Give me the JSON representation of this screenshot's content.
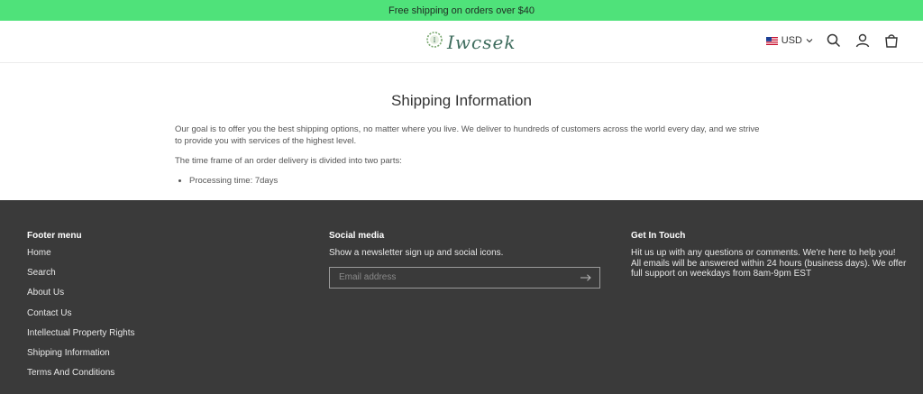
{
  "announcement": "Free shipping on orders over $40",
  "header": {
    "logo_text": "Iwcsek",
    "currency": "USD",
    "icons": [
      "search-icon",
      "account-icon",
      "cart-icon"
    ]
  },
  "main": {
    "title": "Shipping Information",
    "paragraphs": [
      "Our goal is to offer you the best shipping options, no matter where you live. We deliver to hundreds of customers across the world every day, and we strive to provide you with services of the highest level.",
      "The time frame of an order delivery is divided into two parts:"
    ],
    "bullets": [
      "Processing time: 7days"
    ]
  },
  "footer": {
    "menu": {
      "heading": "Footer menu",
      "items": [
        "Home",
        "Search",
        "About Us",
        "Contact Us",
        "Intellectual Property Rights",
        "Shipping Information",
        "Terms And Conditions"
      ]
    },
    "social": {
      "heading": "Social media",
      "text": "Show a newsletter sign up and social icons.",
      "email_placeholder": "Email address"
    },
    "touch": {
      "heading": "Get In Touch",
      "lines": [
        "Hit us up with any questions or comments. We're here to help you!",
        "All emails will be answered within 24 hours (business days). We offer",
        "full support on weekdays from 8am-9pm EST"
      ]
    }
  },
  "colors": {
    "announcement_bg": "#4fe27a",
    "footer_bg": "#3a3a3a",
    "logo": "#3f6d5e"
  }
}
